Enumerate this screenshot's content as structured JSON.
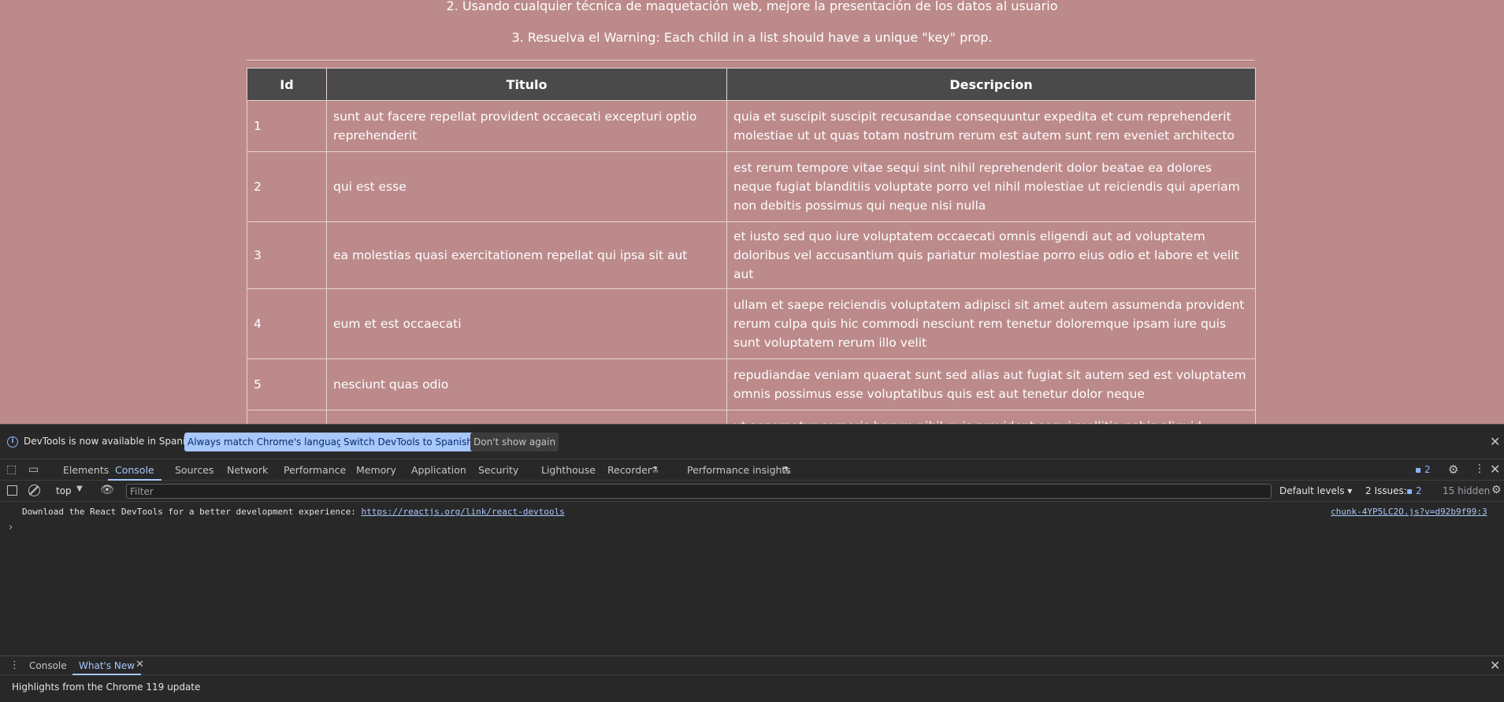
{
  "page": {
    "instructions": [
      "2. Usando cualquier técnica de maquetación web, mejore la presentación de los datos al usuario",
      "3. Resuelva el Warning: Each child in a list should have a unique \"key\" prop."
    ],
    "table": {
      "headers": [
        "Id",
        "Titulo",
        "Descripcion"
      ],
      "rows": [
        {
          "id": "1",
          "title": "sunt aut facere repellat provident occaecati excepturi optio reprehenderit",
          "body": "quia et suscipit suscipit recusandae consequuntur expedita et cum reprehenderit molestiae ut ut quas totam nostrum rerum est autem sunt rem eveniet architecto"
        },
        {
          "id": "2",
          "title": "qui est esse",
          "body": "est rerum tempore vitae sequi sint nihil reprehenderit dolor beatae ea dolores neque fugiat blanditiis voluptate porro vel nihil molestiae ut reiciendis qui aperiam non debitis possimus qui neque nisi nulla"
        },
        {
          "id": "3",
          "title": "ea molestias quasi exercitationem repellat qui ipsa sit aut",
          "body": "et iusto sed quo iure voluptatem occaecati omnis eligendi aut ad voluptatem doloribus vel accusantium quis pariatur molestiae porro eius odio et labore et velit aut"
        },
        {
          "id": "4",
          "title": "eum et est occaecati",
          "body": "ullam et saepe reiciendis voluptatem adipisci sit amet autem assumenda provident rerum culpa quis hic commodi nesciunt rem tenetur doloremque ipsam iure quis sunt voluptatem rerum illo velit"
        },
        {
          "id": "5",
          "title": "nesciunt quas odio",
          "body": "repudiandae veniam quaerat sunt sed alias aut fugiat sit autem sed est voluptatem omnis possimus esse voluptatibus quis est aut tenetur dolor neque"
        },
        {
          "id": "",
          "title": "",
          "body": "ut aspernatur corporis harum nihil quis provident sequi mollitia nobis aliquid molestiae"
        }
      ]
    },
    "colors": {
      "page_background": "#bc8a8a",
      "table_header": "#4a4a4a"
    }
  },
  "devtools": {
    "infobar": {
      "icon": "info-icon",
      "message": "DevTools is now available in Spanish!",
      "btn_match": "Always match Chrome's language",
      "btn_switch": "Switch DevTools to Spanish",
      "btn_dont": "Don't show again",
      "close_icon": "close-icon"
    },
    "tabs": [
      "Elements",
      "Console",
      "Sources",
      "Network",
      "Performance",
      "Memory",
      "Application",
      "Security",
      "Lighthouse",
      "Recorder",
      "Performance insights"
    ],
    "active_tab": "Console",
    "issues_badge": "2",
    "console_toolbar": {
      "context": "top",
      "filter_placeholder": "Filter",
      "levels": "Default levels",
      "issues_label": "2 Issues:",
      "issues_count": "2",
      "hidden": "15 hidden"
    },
    "console": {
      "message": "Download the React DevTools for a better development experience: ",
      "link": "https://reactjs.org/link/react-devtools",
      "source": "chunk-4YP5LC2O.js?v=d92b9f99:3",
      "prompt": "›"
    },
    "drawer": {
      "tabs": [
        "Console",
        "What's New"
      ],
      "active_tab": "What's New",
      "content": "Highlights from the Chrome 119 update"
    },
    "accent_color": "#a8c7fa"
  }
}
